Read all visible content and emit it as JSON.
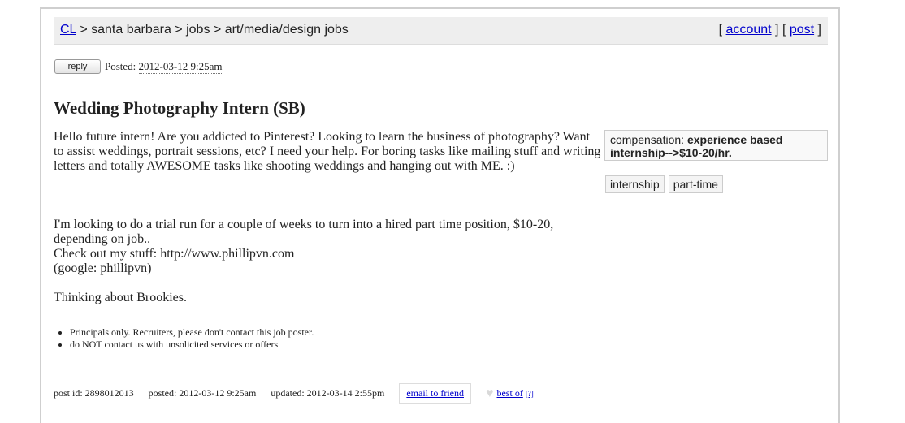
{
  "breadcrumbs": {
    "home": "CL",
    "separator": ">",
    "city": "santa barbara",
    "category": "jobs",
    "subcategory": "art/media/design jobs"
  },
  "userlinks": {
    "open_bracket": "[",
    "account": "account",
    "mid": "] [",
    "post": "post",
    "close_bracket": "]"
  },
  "posting": {
    "reply_label": "reply",
    "posted_label": "Posted:",
    "posted_date": "2012-03-12 9:25am"
  },
  "title": "Wedding Photography Intern (SB)",
  "body": {
    "p1": "Hello future intern! Are you addicted to Pinterest? Looking to learn the business of photography? Want to assist weddings, portrait sessions, etc? I need your help. For boring tasks like mailing stuff and writing letters and totally AWESOME tasks like shooting weddings and hanging out with ME. :)",
    "p2_line1": "I'm looking to do a trial run for a couple of weeks to turn into a hired part time position, $10-20, depending on job..",
    "p2_line2": "Check out my stuff: http://www.phillipvn.com",
    "p2_line3": "(google: phillipvn)",
    "p3": "Thinking about Brookies."
  },
  "attributes": {
    "compensation_label": "compensation:",
    "compensation_value": "experience based internship-->$10-20/hr."
  },
  "tags": [
    "internship",
    "part-time"
  ],
  "notices": [
    "Principals only. Recruiters, please don't contact this job poster.",
    "do NOT contact us with unsolicited services or offers"
  ],
  "footer": {
    "post_id": "post id: 2898012013",
    "posted_label": "posted:",
    "posted_date": "2012-03-12 9:25am",
    "updated_label": "updated:",
    "updated_date": "2012-03-14 2:55pm",
    "email_label": "email to friend",
    "bestof_label": "best of",
    "help_label": "[?]"
  },
  "colors": {
    "link": "#0000cc",
    "topbar_bg": "#eeeeee"
  }
}
